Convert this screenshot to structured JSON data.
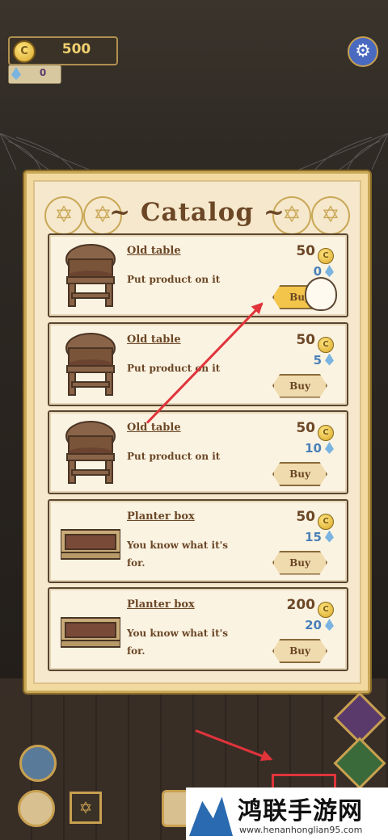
{
  "hud": {
    "coins": "500",
    "gems": "0",
    "coin_symbol": "C"
  },
  "catalog": {
    "title": "~ Catalog ~",
    "buy_label": "Buy",
    "items": [
      {
        "name": "Old table",
        "desc": "Put product on it",
        "price": "50",
        "gems": "0",
        "image": "table"
      },
      {
        "name": "Old table",
        "desc": "Put product on it",
        "price": "50",
        "gems": "5",
        "image": "table"
      },
      {
        "name": "Old table",
        "desc": "Put product on it",
        "price": "50",
        "gems": "10",
        "image": "table"
      },
      {
        "name": "Planter box",
        "desc": "You know what it's for.",
        "price": "50",
        "gems": "15",
        "image": "planter"
      },
      {
        "name": "Planter box",
        "desc": "You know what it's for.",
        "price": "200",
        "gems": "20",
        "image": "planter"
      }
    ]
  },
  "watermark": {
    "title": "鸿联手游网",
    "url": "www.henanhonglian95.com"
  },
  "colors": {
    "annotation": "#e0343a",
    "panel": "#f2d9a0",
    "text": "#6b4726"
  }
}
